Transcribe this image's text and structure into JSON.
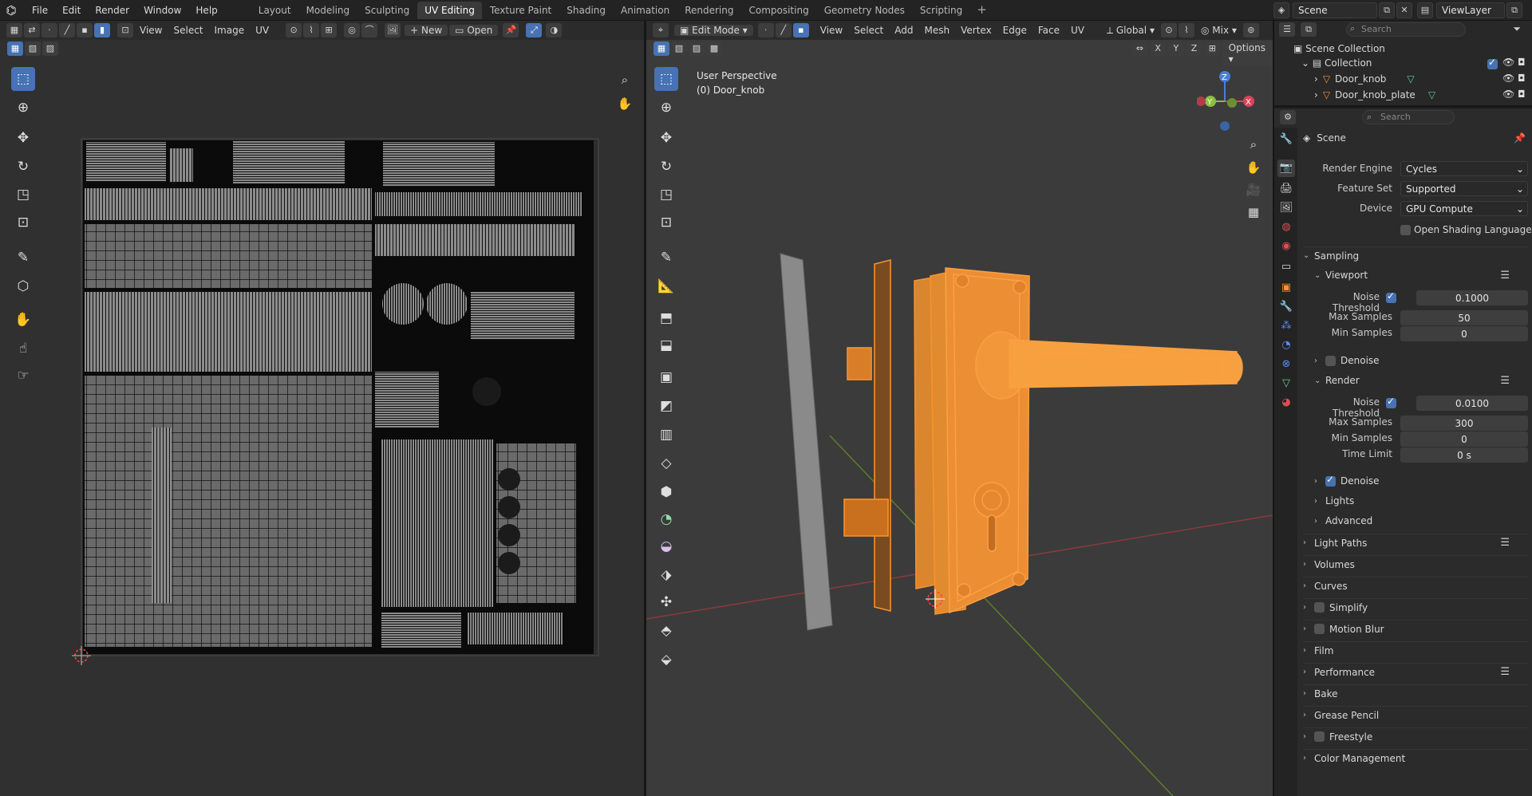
{
  "menu": {
    "items": [
      "File",
      "Edit",
      "Render",
      "Window",
      "Help"
    ]
  },
  "workspaces": {
    "tabs": [
      "Layout",
      "Modeling",
      "Sculpting",
      "UV Editing",
      "Texture Paint",
      "Shading",
      "Animation",
      "Rendering",
      "Compositing",
      "Geometry Nodes",
      "Scripting"
    ],
    "active": "UV Editing"
  },
  "top_right": {
    "scene": "Scene",
    "view_layer": "ViewLayer"
  },
  "uv_editor": {
    "header": {
      "view": "View",
      "select": "Select",
      "image": "Image",
      "uv": "UV",
      "new": "New",
      "open": "Open"
    }
  },
  "viewport": {
    "header": {
      "mode": "Edit Mode",
      "view": "View",
      "select": "Select",
      "add": "Add",
      "mesh": "Mesh",
      "vertex": "Vertex",
      "edge": "Edge",
      "face": "Face",
      "uv": "UV",
      "orientation": "Global",
      "mix": "Mix",
      "options": "Options",
      "x": "X",
      "y": "Y",
      "z": "Z"
    },
    "overlay_title": "User Perspective",
    "overlay_object": "(0) Door_knob",
    "gizmo": {
      "x": "X",
      "y": "Y",
      "z": "Z"
    }
  },
  "outliner": {
    "search_placeholder": "Search",
    "scene_collection": "Scene Collection",
    "collection": "Collection",
    "objects": [
      "Door_knob",
      "Door_knob_plate"
    ]
  },
  "properties": {
    "search_placeholder": "Search",
    "title": "Scene",
    "render_engine": {
      "label": "Render Engine",
      "value": "Cycles"
    },
    "feature_set": {
      "label": "Feature Set",
      "value": "Supported"
    },
    "device": {
      "label": "Device",
      "value": "GPU Compute"
    },
    "osl": "Open Shading Language",
    "sampling": "Sampling",
    "viewport": {
      "title": "Viewport",
      "noise_threshold_label": "Noise Threshold",
      "noise_threshold": "0.1000",
      "max_samples_label": "Max Samples",
      "max_samples": "50",
      "min_samples_label": "Min Samples",
      "min_samples": "0",
      "denoise": "Denoise"
    },
    "render": {
      "title": "Render",
      "noise_threshold_label": "Noise Threshold",
      "noise_threshold": "0.0100",
      "max_samples_label": "Max Samples",
      "max_samples": "300",
      "min_samples_label": "Min Samples",
      "min_samples": "0",
      "time_limit_label": "Time Limit",
      "time_limit": "0 s",
      "denoise": "Denoise"
    },
    "lights": "Lights",
    "advanced": "Advanced",
    "panels": [
      "Light Paths",
      "Volumes",
      "Curves",
      "Simplify",
      "Motion Blur",
      "Film",
      "Performance",
      "Bake",
      "Grease Pencil",
      "Freestyle",
      "Color Management"
    ]
  },
  "colors": {
    "accent": "#4772b3",
    "selected_mesh": "#f7922a",
    "background": "#303030"
  }
}
